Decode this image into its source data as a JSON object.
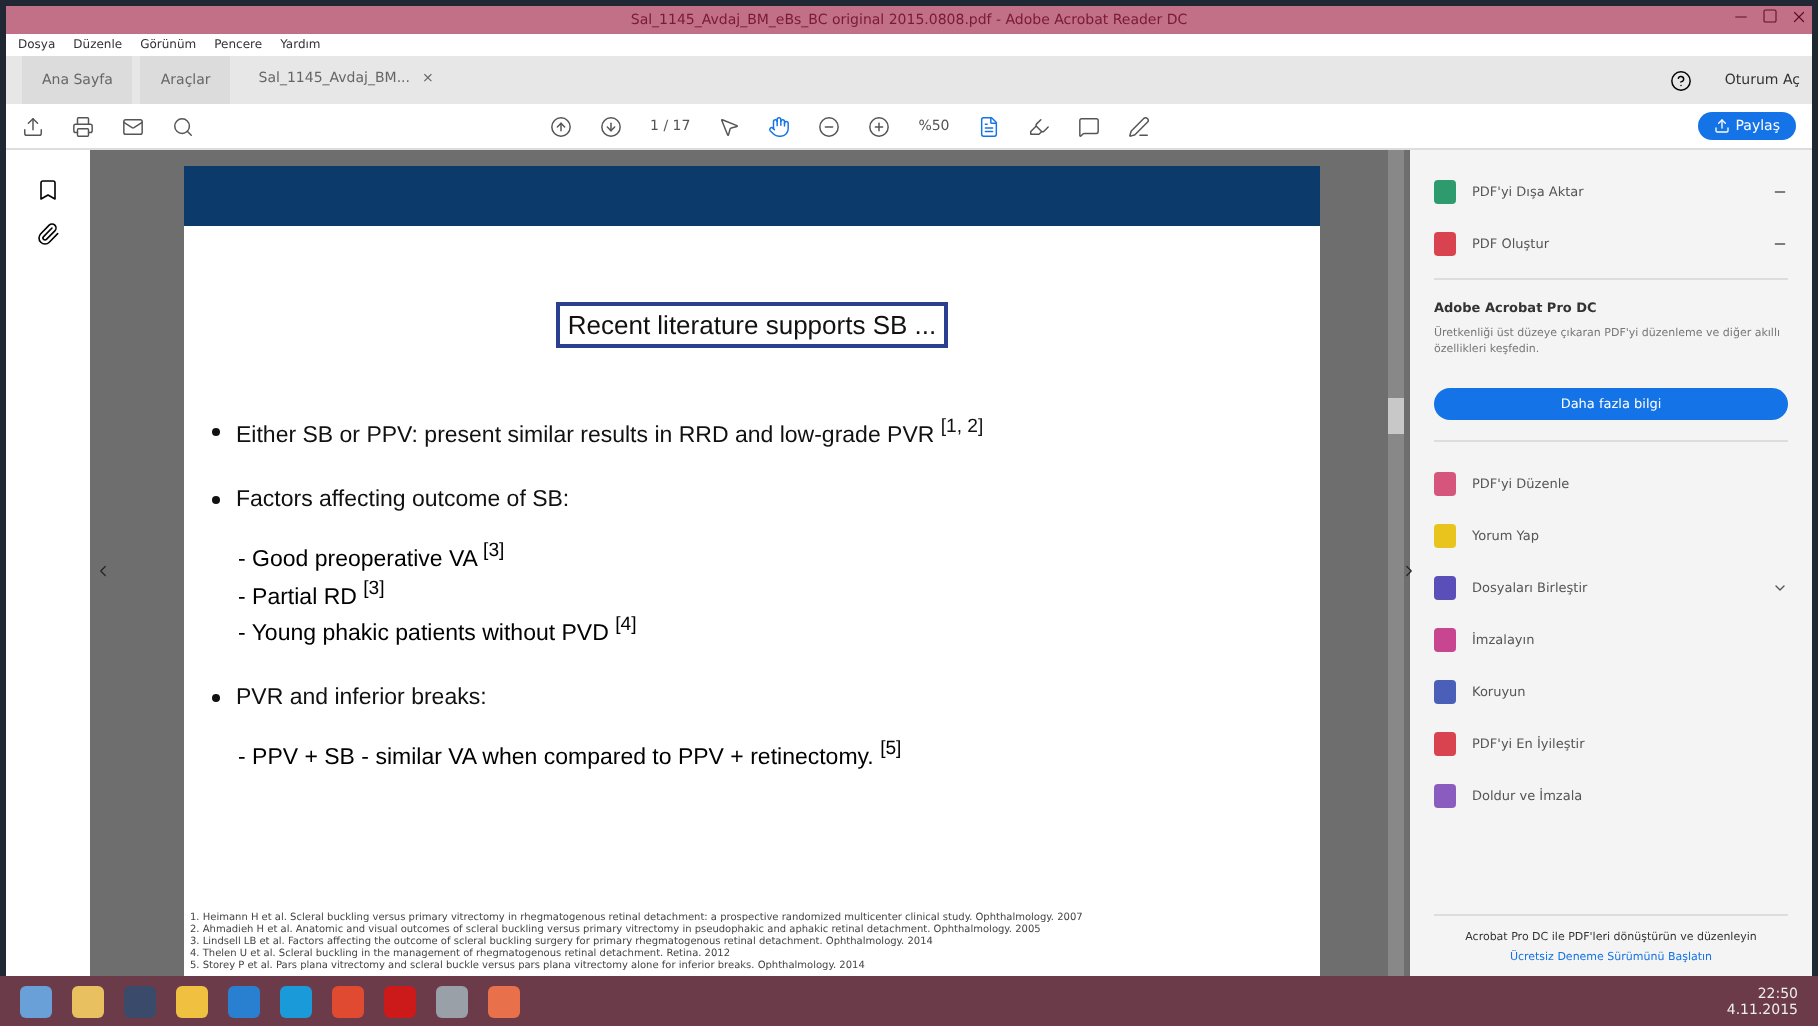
{
  "window": {
    "title": "Sal_1145_Avdaj_BM_eBs_BC original 2015.0808.pdf - Adobe Acrobat Reader DC"
  },
  "menu": [
    "Dosya",
    "Düzenle",
    "Görünüm",
    "Pencere",
    "Yardım"
  ],
  "tabs": [
    {
      "label": "Ana Sayfa",
      "selected": false
    },
    {
      "label": "Araçlar",
      "selected": false
    },
    {
      "label": "Sal_1145_Avdaj_BM...",
      "selected": true,
      "close": "×"
    }
  ],
  "account": {
    "sign_in": "Oturum Aç"
  },
  "toolbar": {
    "page": "1",
    "page_count": "/ 17",
    "zoom": "%50",
    "share": "Paylaş"
  },
  "slide": {
    "title": "Recent literature supports SB ...",
    "bullets": [
      {
        "text": "Either SB or PPV: present similar results in RRD and low-grade PVR $^{[1, 2]}$"
      },
      {
        "text": "Factors affecting outcome of SB:",
        "sub": [
          "- Good preoperative VA $^{[3]}$",
          "- Partial RD $^{[3]}$",
          "- Young phakic patients without PVD $^{[4]}$"
        ]
      },
      {
        "text": "PVR and inferior breaks:",
        "sub": [
          "- PPV + SB - similar VA when compared to PPV + retinectomy. $^{[5]}$"
        ]
      }
    ],
    "footnotes": [
      "1. Heimann H et al. Scleral buckling versus primary vitrectomy in rhegmatogenous retinal detachment: a prospective randomized multicenter clinical study. Ophthalmology. 2007",
      "2. Ahmadieh H et al. Anatomic and visual outcomes of scleral buckling versus primary vitrectomy in pseudophakic and aphakic retinal detachment. Ophthalmology. 2005",
      "3. Lindsell LB et al. Factors affecting the outcome of scleral buckling surgery for primary rhegmatogenous retinal detachment. Ophthalmology. 2014",
      "4. Thelen U et al. Scleral buckling in the management of rhegmatogenous retinal detachment. Retina. 2012",
      "5. Storey P et al. Pars plana vitrectomy and scleral buckle versus pars plana vitrectomy alone for inferior breaks. Ophthalmology. 2014"
    ]
  },
  "panel": {
    "top_tools": [
      {
        "label": "PDF'yi Dışa Aktar",
        "expanded": false,
        "color": "#2e9b6e"
      },
      {
        "label": "PDF Oluştur",
        "expanded": false,
        "color": "#d9434f"
      }
    ],
    "promo": {
      "title": "Adobe Acrobat Pro DC",
      "text": "Üretkenliği üst düzeye çıkaran PDF'yi düzenleme ve diğer akıllı özellikleri keşfedin.",
      "button": "Daha fazla bilgi"
    },
    "tools": [
      {
        "label": "PDF'yi Düzenle",
        "color": "#d6557d",
        "expandable": false
      },
      {
        "label": "Yorum Yap",
        "color": "#e8c41c",
        "expandable": false
      },
      {
        "label": "Dosyaları Birleştir",
        "color": "#5a4fb8",
        "expandable": true
      },
      {
        "label": "İmzalayın",
        "color": "#c8458f",
        "expandable": false
      },
      {
        "label": "Koruyun",
        "color": "#4a5fb8",
        "expandable": false
      },
      {
        "label": "PDF'yi En İyileştir",
        "color": "#d9434f",
        "expandable": false
      },
      {
        "label": "Doldur ve İmzala",
        "color": "#8b5cc0",
        "expandable": false
      }
    ],
    "footer": "Acrobat Pro DC ile PDF'leri dönüştürün ve düzenleyin",
    "link": "Ücretsiz Deneme Sürümünü Başlatın"
  },
  "taskbar": {
    "time": "22:50",
    "date": "4.11.2015"
  }
}
